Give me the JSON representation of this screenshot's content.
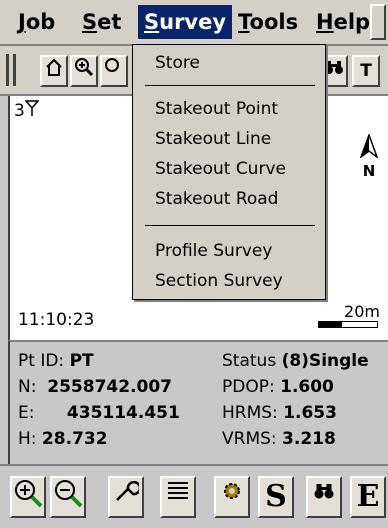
{
  "menubar": {
    "items": [
      {
        "label": "Job",
        "underline": "J",
        "rest": "ob"
      },
      {
        "label": "Set",
        "underline": "S",
        "rest": "et"
      },
      {
        "label": "Survey",
        "underline": "S",
        "rest": "urvey"
      },
      {
        "label": "Tools",
        "underline": "T",
        "rest": "ools"
      },
      {
        "label": "Help",
        "underline": "H",
        "rest": "elp"
      }
    ]
  },
  "toolbar": {
    "icons": [
      "home-icon",
      "zoom-in-icon",
      "zoom-icon",
      "binoculars-icon",
      "tag-icon"
    ],
    "tag_glyph": "T"
  },
  "survey_menu": {
    "items": [
      "Store",
      "Stakeout Point",
      "Stakeout Line",
      "Stakeout Curve",
      "Stakeout Road",
      "Profile Survey",
      "Section Survey"
    ]
  },
  "map": {
    "satellite_count": "3",
    "north_label": "N",
    "time": "11:10:23",
    "scale_label": "20m"
  },
  "info": {
    "pt_id_label": "Pt ID:",
    "pt_id_value": "PT",
    "n_label": "N:",
    "n_value": "2558742.007",
    "e_label": "E:",
    "e_value": "435114.451",
    "h_label": "H:",
    "h_value": "28.732",
    "status_label": "Status",
    "status_value": "(8)Single",
    "pdop_label": "PDOP:",
    "pdop_value": "1.600",
    "hrms_label": "HRMS:",
    "hrms_value": "1.653",
    "vrms_label": "VRMS:",
    "vrms_value": "3.218"
  },
  "bottombar": {
    "icons": [
      "zoom-in-icon",
      "zoom-out-icon",
      "wrench-icon",
      "list-icon",
      "gear-icon",
      "s-icon",
      "binoculars-icon",
      "e-icon"
    ],
    "s_glyph": "S",
    "e_glyph": "E"
  },
  "colors": {
    "menu_highlight": "#0a246a",
    "panel": "#d4d0c8",
    "map_background": "#ffffff"
  }
}
